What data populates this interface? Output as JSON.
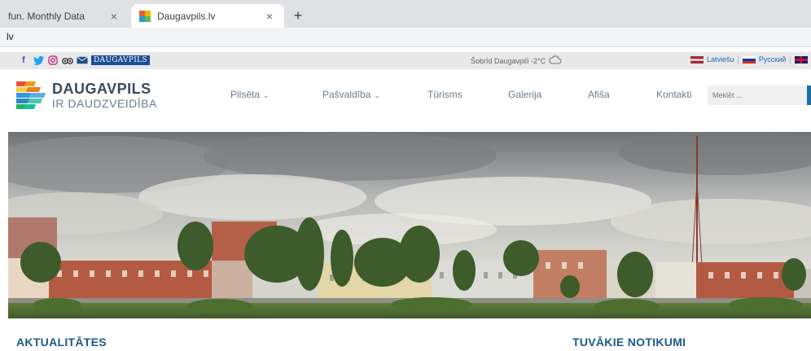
{
  "browser": {
    "tabs": [
      {
        "title": "fun. Monthly Data",
        "active": false
      },
      {
        "title": "Daugavpils.lv",
        "active": true
      }
    ],
    "new_tab": "+",
    "close_glyph": "×",
    "address": "lv"
  },
  "topbar": {
    "social_icons": [
      "facebook-icon",
      "twitter-icon",
      "instagram-icon",
      "tripadvisor-icon",
      "mail-icon"
    ],
    "daugavpils_badge": "DAUGAVPILS",
    "weather": "Šobrīd Daugavpilī -2°C",
    "languages": [
      {
        "label": "Latviešu"
      },
      {
        "label": "Русский"
      },
      {
        "label": "E"
      }
    ]
  },
  "header": {
    "logo_line1": "DAUGAVPILS",
    "logo_line2": "IR DAUDZVEIDĪBA",
    "nav": [
      {
        "label": "Pilsēta",
        "dropdown": true
      },
      {
        "label": "Pašvaldība",
        "dropdown": true
      },
      {
        "label": "Tūrisms",
        "dropdown": false
      },
      {
        "label": "Galerija",
        "dropdown": false
      },
      {
        "label": "Afiša",
        "dropdown": false
      },
      {
        "label": "Kontakti",
        "dropdown": false
      }
    ],
    "search_placeholder": "Meklēt ..."
  },
  "sections": {
    "news_title": "AKTUALITĀTES",
    "events_title": "TUVĀKIE NOTIKUMI"
  },
  "colors": {
    "accent": "#1c5a8a",
    "badge": "#1c4e96"
  }
}
